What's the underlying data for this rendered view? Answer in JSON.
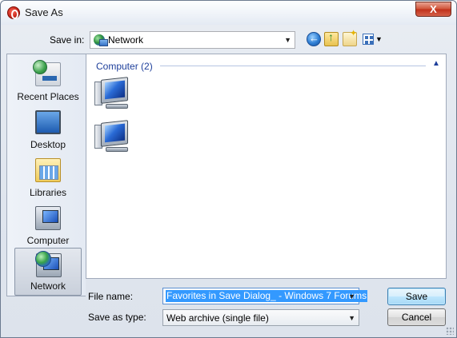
{
  "window": {
    "title": "Save As",
    "close_label": "X"
  },
  "toolbar": {
    "save_in_label": "Save in:",
    "save_in_value": "Network",
    "icons": [
      "back-icon",
      "up-folder-icon",
      "new-folder-icon",
      "views-menu-icon"
    ]
  },
  "places": [
    {
      "label": "Recent Places",
      "icon": "recent-places-icon"
    },
    {
      "label": "Desktop",
      "icon": "desktop-icon"
    },
    {
      "label": "Libraries",
      "icon": "libraries-icon"
    },
    {
      "label": "Computer",
      "icon": "computer-icon"
    },
    {
      "label": "Network",
      "icon": "network-icon",
      "selected": true
    }
  ],
  "main": {
    "group_header": "Computer (2)",
    "items": [
      {
        "icon": "computer-icon",
        "label": ""
      },
      {
        "icon": "computer-icon",
        "label": ""
      }
    ]
  },
  "form": {
    "file_name_label": "File name:",
    "file_name_value": "Favorites in Save Dialog_ - Windows 7 Forums",
    "save_type_label": "Save as type:",
    "save_type_value": "Web archive (single file)"
  },
  "buttons": {
    "save": "Save",
    "cancel": "Cancel"
  },
  "colors": {
    "accent": "#3399ff",
    "group_header": "#1e3f9b",
    "close": "#c1301a"
  }
}
